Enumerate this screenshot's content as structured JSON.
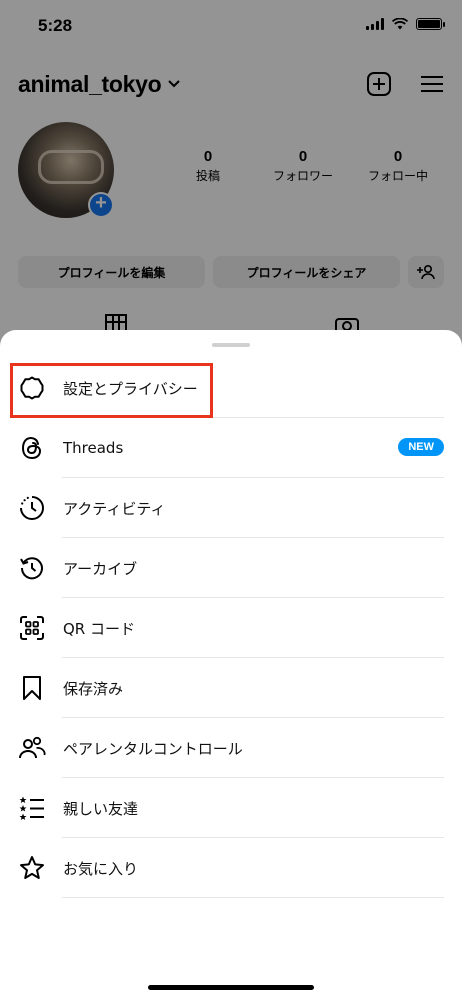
{
  "status_bar": {
    "time": "5:28"
  },
  "header": {
    "username": "animal_tokyo"
  },
  "stats": [
    {
      "value": "0",
      "label": "投稿"
    },
    {
      "value": "0",
      "label": "フォロワー"
    },
    {
      "value": "0",
      "label": "フォロー中"
    }
  ],
  "profile_buttons": {
    "edit": "プロフィールを編集",
    "share": "プロフィールをシェア"
  },
  "menu": {
    "settings": "設定とプライバシー",
    "threads": "Threads",
    "threads_badge": "NEW",
    "activity": "アクティビティ",
    "archive": "アーカイブ",
    "qr": "QR コード",
    "saved": "保存済み",
    "parental": "ペアレンタルコントロール",
    "close_friends": "親しい友達",
    "favorites": "お気に入り"
  },
  "colors": {
    "highlight": "#e8341c",
    "badge": "#0095f6",
    "avatar_plus": "#1877f2"
  }
}
